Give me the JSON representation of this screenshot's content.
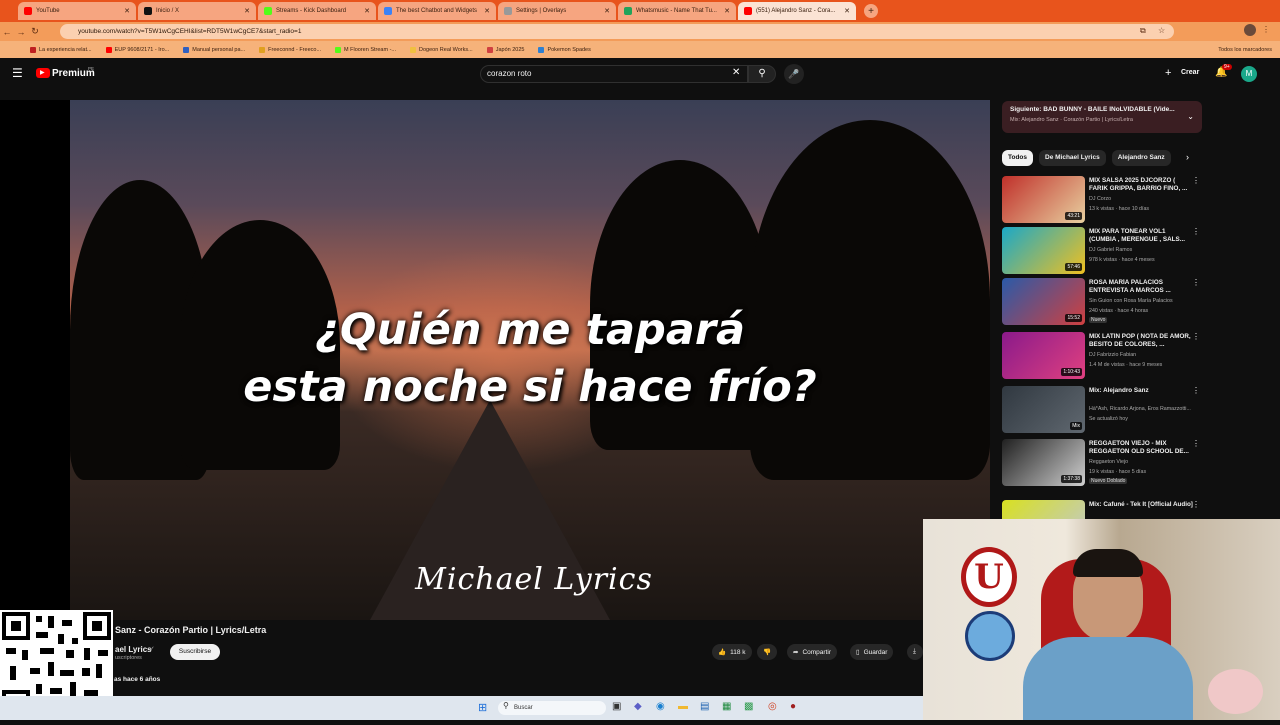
{
  "browser": {
    "tabs": [
      {
        "label": "YouTube",
        "color": "#ff0000"
      },
      {
        "label": "Inicio / X",
        "color": "#111111"
      },
      {
        "label": "Streams - Kick Dashboard",
        "color": "#53fc18"
      },
      {
        "label": "The best Chatbot and Widgets",
        "color": "#3b82f6"
      },
      {
        "label": "Settings | Overlays",
        "color": "#e1e1e1"
      },
      {
        "label": "Whatsmusic - Name That Tu...",
        "color": "#22a35a"
      },
      {
        "label": "(551) Alejandro Sanz - Cora...",
        "color": "#ff0000"
      }
    ],
    "url": "youtube.com/watch?v=T5W1wCgCEHI&list=RDT5W1wCgCE7&start_radio=1",
    "bookmarks": [
      "La experiencia relat...",
      "EUP 9608/2171 - Iro...",
      "Manual personal pa...",
      "Freeconnd - Freeco...",
      "M Flooren Stream -...",
      "Dogeon Real Works...",
      "Japón 2025",
      "Pokemon Spades"
    ],
    "all_bookmarks_label": "Todos los marcadores"
  },
  "header": {
    "logo_label": "Premium",
    "logo_sup": "PE",
    "search_value": "corazon roto",
    "create_label": "Crear",
    "notif_count": "9+",
    "avatar_letter": "M"
  },
  "player": {
    "lyric_line1": "¿Quién me tapará",
    "lyric_line2": "esta noche si hace frío?",
    "watermark": "Michael Lyrics"
  },
  "video": {
    "title": "Sanz - Corazón Partio | Lyrics/Letra",
    "channel": "ael Lyrics",
    "subscribers": "uscriptores",
    "subscribe_label": "Suscribirse",
    "likes": "118 k",
    "share_label": "Compartir",
    "save_label": "Guardar",
    "description_meta": "as  hace 6 años"
  },
  "sidebar": {
    "upnext_title": "Siguiente: BAD BUNNY - BAILE INoLVIDABLE (Vide...",
    "upnext_sub": "Mix: Alejandro Sanz · Corazón Partio | Lyrics/Letra",
    "chips": [
      "Todos",
      "De Michael Lyrics",
      "Alejandro Sanz"
    ],
    "recommendations": [
      {
        "title": "MIX SALSA 2025 DJCORZO ( FARIK GRIPPA, BARRIO FINO, ...",
        "channel": "DJ Corzo",
        "meta": "13 k vistas · hace 10 días",
        "duration": "43:21",
        "badge": "",
        "color1": "#c0302a",
        "color2": "#e8d0a0"
      },
      {
        "title": "MIX PARA TONEAR VOL1 (CUMBIA , MERENGUE , SALS...",
        "channel": "DJ Gabriel Ramos",
        "meta": "978 k vistas · hace 4 meses",
        "duration": "57:46",
        "badge": "",
        "color1": "#1aa8c8",
        "color2": "#f0c020"
      },
      {
        "title": "ROSA MARÍA PALACIOS ENTREVISTA A MARCOS ...",
        "channel": "Sin Guion con Rosa María Palacios",
        "meta": "240 vistas · hace 4 horas",
        "duration": "15:52",
        "badge": "Nuevo",
        "color1": "#2a5aa8",
        "color2": "#d04040"
      },
      {
        "title": "MIX LATIN POP ( NOTA DE AMOR, BESITO DE COLORES, ...",
        "channel": "DJ Fabrizzio Fabian",
        "meta": "1.4 M de vistas · hace 9 meses",
        "duration": "1:10:43",
        "badge": "",
        "color1": "#8a1a8a",
        "color2": "#e04080"
      },
      {
        "title": "Mix: Alejandro Sanz",
        "channel": "Hà*Ash, Ricardo Arjona, Eros Ramazzotti...",
        "meta": "Se actualizó hoy",
        "duration": "Mix",
        "badge": "",
        "color1": "#303840",
        "color2": "#606870"
      },
      {
        "title": "REGGAETON VIEJO - MIX REGGAETON OLD SCHOOL DE...",
        "channel": "Reggaeton Viejo",
        "meta": "19 k vistas · hace 5 días",
        "duration": "1:37:38",
        "badge": "Nuevo  Doblado",
        "color1": "#202020",
        "color2": "#d0d0d0"
      },
      {
        "title": "Mix: Cafuné - Tek It [Official Audio]",
        "channel": "",
        "meta": "",
        "duration": "",
        "badge": "",
        "color1": "#d8e020",
        "color2": "#c0c8d0"
      }
    ]
  },
  "taskbar": {
    "search_placeholder": "Buscar"
  }
}
